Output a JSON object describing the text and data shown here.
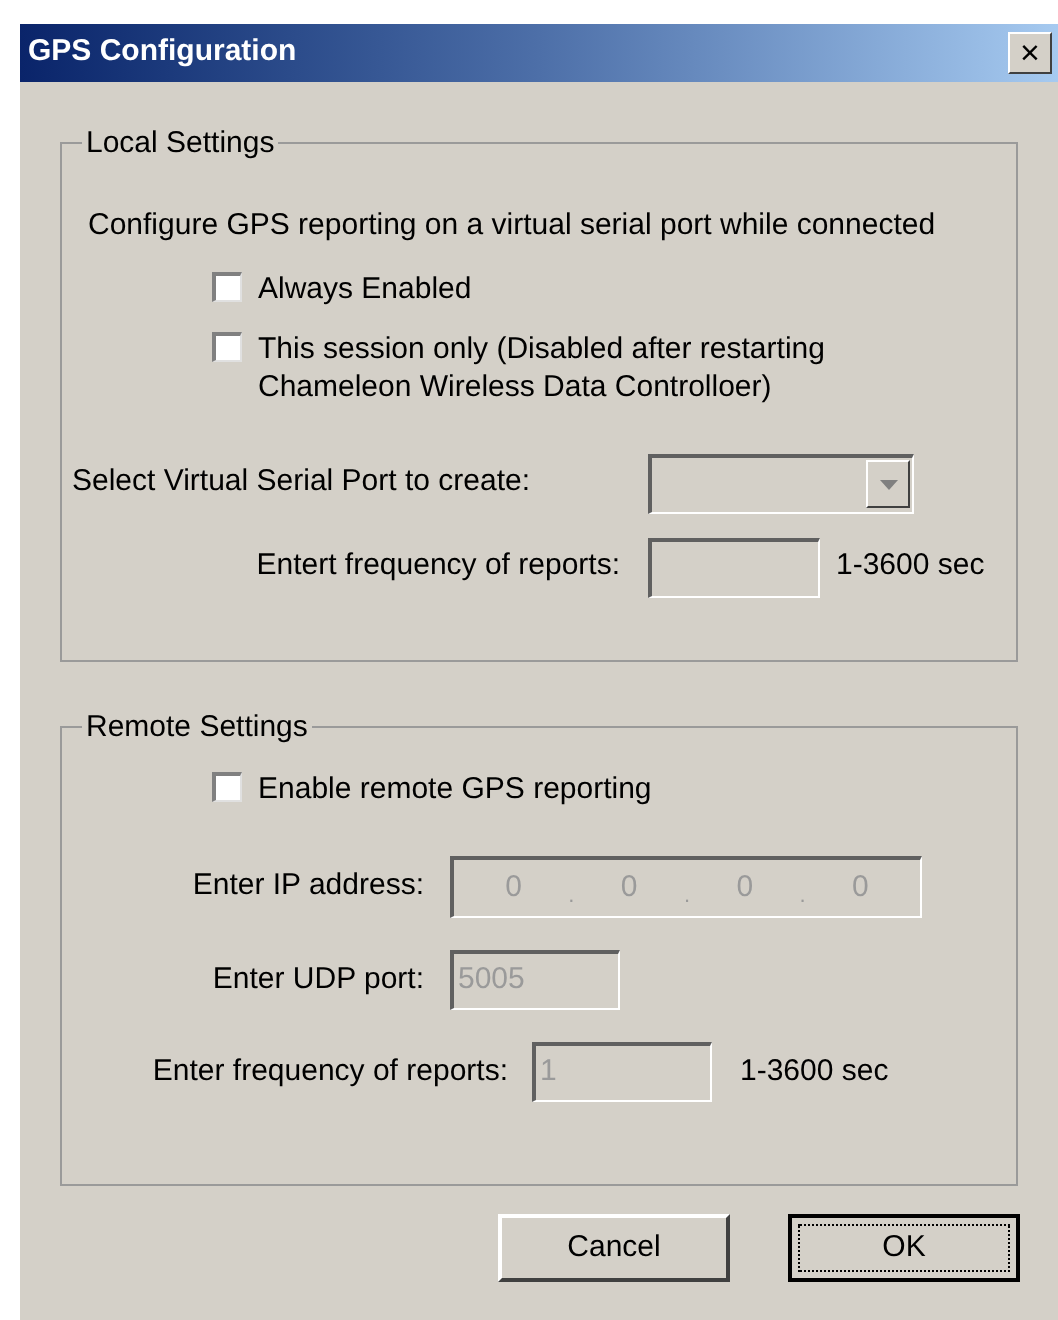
{
  "window": {
    "title": "GPS Configuration",
    "close": "×"
  },
  "local_settings": {
    "title": "Local Settings",
    "description": "Configure GPS reporting on a virtual serial port while connected",
    "checkboxes": [
      {
        "label": "Always Enabled",
        "checked": false
      },
      {
        "label": "This session only (Disabled after restarting Chameleon Wireless Data Controlloer)",
        "checked": false
      }
    ],
    "port_select": {
      "label": "Select Virtual Serial Port to create:",
      "disabled": true
    },
    "frequency": {
      "label": "Entert frequency of reports:",
      "disabled": true,
      "unit": "1-3600 sec"
    }
  },
  "remote_settings": {
    "title": "Remote Settings",
    "checkbox": {
      "label": "Enable remote GPS reporting",
      "checked": false
    },
    "ip": {
      "label": "Enter IP address:",
      "octets": [
        "0",
        "0",
        "0",
        "0"
      ],
      "separator": ".",
      "disabled": true
    },
    "udp_port": {
      "label": "Enter UDP port:",
      "value": "5005",
      "disabled": true
    },
    "frequency": {
      "label": "Enter frequency of reports:",
      "value": "1",
      "disabled": true,
      "unit": "1-3600 sec"
    }
  },
  "buttons": [
    {
      "label": "Cancel",
      "default": false
    },
    {
      "label": "OK",
      "default": true
    }
  ]
}
